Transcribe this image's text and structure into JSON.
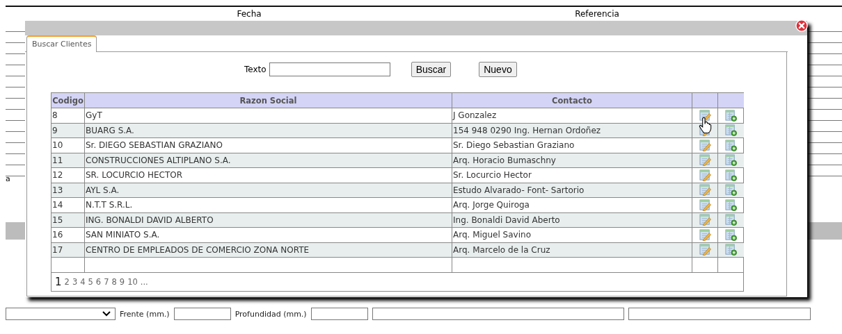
{
  "background_form": {
    "headers": [
      "Fecha",
      "Referencia"
    ],
    "side_label": "a",
    "fields": [
      {
        "kind": "select"
      },
      {
        "kind": "label",
        "text": "Frente (mm.)"
      },
      {
        "kind": "input"
      },
      {
        "kind": "label",
        "text": "Profundidad (mm.)"
      },
      {
        "kind": "input"
      },
      {
        "kind": "wide_input"
      },
      {
        "kind": "wide_input"
      }
    ]
  },
  "dialog": {
    "tabs": [
      {
        "label": "Buscar Clientes",
        "selected": true
      }
    ],
    "search": {
      "label": "Texto"
    },
    "buttons": [
      "Buscar",
      "Nuevo"
    ],
    "table": {
      "columns": [
        "Codigo",
        "Razon Social",
        "Contacto",
        "",
        ""
      ],
      "rows": [
        {
          "codigo": "8",
          "razon_social": "GyT",
          "contacto": "J Gonzalez"
        },
        {
          "codigo": "9",
          "razon_social": "BUARG S.A.",
          "contacto": "154 948 0290 Ing. Hernan Ordoñez"
        },
        {
          "codigo": "10",
          "razon_social": "Sr. DIEGO SEBASTIAN GRAZIANO",
          "contacto": "Sr. Diego Sebastian Graziano"
        },
        {
          "codigo": "11",
          "razon_social": "CONSTRUCCIONES ALTIPLANO S.A.",
          "contacto": "Arq. Horacio Bumaschny"
        },
        {
          "codigo": "12",
          "razon_social": "SR. LOCURCIO HECTOR",
          "contacto": "Sr. Locurcio Hector"
        },
        {
          "codigo": "13",
          "razon_social": "AYL S.A.",
          "contacto": "Estudo Alvarado- Font- Sartorio"
        },
        {
          "codigo": "14",
          "razon_social": "N.T.T S.R.L.",
          "contacto": "Arq. Jorge Quiroga"
        },
        {
          "codigo": "15",
          "razon_social": "ING. BONALDI DAVID ALBERTO",
          "contacto": "Ing. Bonaldi David Aberto"
        },
        {
          "codigo": "16",
          "razon_social": "SAN MINIATO S.A.",
          "contacto": "Arq. Miguel Savino"
        },
        {
          "codigo": "17",
          "razon_social": "CENTRO DE EMPLEADOS DE COMERCIO ZONA NORTE",
          "contacto": "Arq. Marcelo de la Cruz"
        }
      ]
    },
    "pager": [
      {
        "label": "1",
        "selected": true
      },
      {
        "label": "2",
        "selected": false
      },
      {
        "label": "3",
        "selected": false
      },
      {
        "label": "4",
        "selected": false
      },
      {
        "label": "5",
        "selected": false
      },
      {
        "label": "6",
        "selected": false
      },
      {
        "label": "7",
        "selected": false
      },
      {
        "label": "8",
        "selected": false
      },
      {
        "label": "9",
        "selected": false
      },
      {
        "label": "10",
        "selected": false
      },
      {
        "label": "...",
        "selected": false
      }
    ]
  }
}
